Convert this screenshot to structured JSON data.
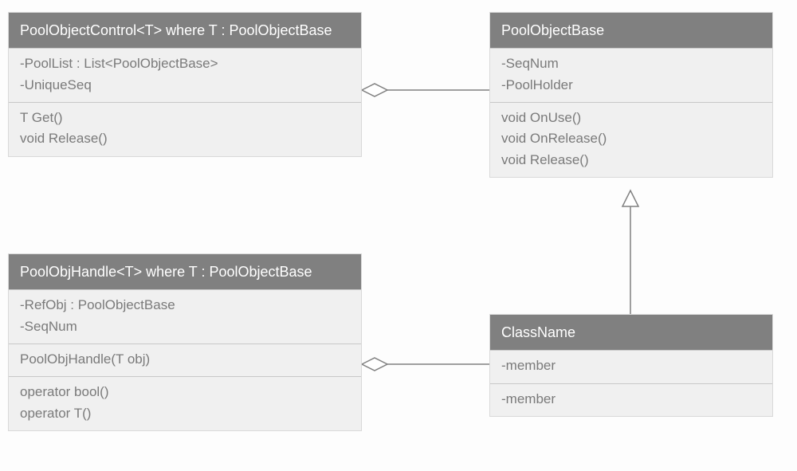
{
  "classes": {
    "poolObjectControl": {
      "title": "PoolObjectControl<T> where T : PoolObjectBase",
      "attrs": [
        "-PoolList : List<PoolObjectBase>",
        "-UniqueSeq"
      ],
      "ops": [
        "T Get()",
        "void Release()"
      ]
    },
    "poolObjectBase": {
      "title": "PoolObjectBase",
      "attrs": [
        "-SeqNum",
        "-PoolHolder"
      ],
      "ops": [
        "void OnUse()",
        "void OnRelease()",
        "void Release()"
      ]
    },
    "poolObjHandle": {
      "title": "PoolObjHandle<T> where T : PoolObjectBase",
      "attrs": [
        "-RefObj : PoolObjectBase",
        "-SeqNum"
      ],
      "ops1": [
        "PoolObjHandle(T obj)"
      ],
      "ops2": [
        "operator bool()",
        "operator T()"
      ]
    },
    "className": {
      "title": "ClassName",
      "attrs": [
        "-member"
      ],
      "ops": [
        "-member"
      ]
    }
  }
}
